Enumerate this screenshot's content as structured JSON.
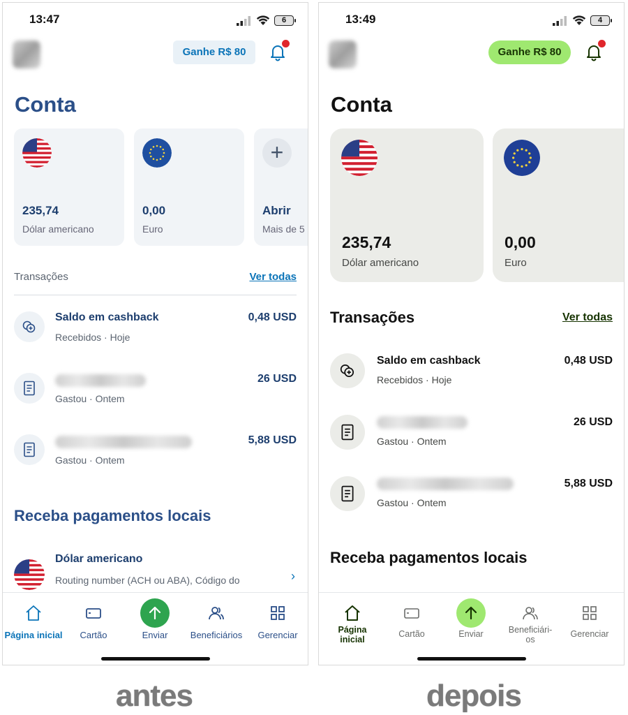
{
  "before": {
    "time": "13:47",
    "battery": "6",
    "earn_label": "Ganhe R$ 80",
    "title": "Conta",
    "cards": [
      {
        "amount": "235,74",
        "currency": "Dólar americano"
      },
      {
        "amount": "0,00",
        "currency": "Euro"
      },
      {
        "amount": "Abrir",
        "currency": "Mais de 5"
      }
    ],
    "transactions_label": "Transações",
    "see_all": "Ver todas",
    "transactions": [
      {
        "name": "Saldo em cashback",
        "sub": "Recebidos · Hoje",
        "value": "0,48 USD"
      },
      {
        "name": "",
        "sub": "Gastou · Ontem",
        "value": "26 USD"
      },
      {
        "name": "",
        "sub": "Gastou · Ontem",
        "value": "5,88 USD"
      }
    ],
    "receive_title": "Receba pagamentos locais",
    "local": {
      "name": "Dólar americano",
      "desc": "Routing number (ACH ou ABA), Código do banco (SWIFT/BIC), Número da conta"
    },
    "tabs": [
      "Página inicial",
      "Cartão",
      "Enviar",
      "Beneficiários",
      "Gerenciar"
    ],
    "caption": "antes",
    "colors": {
      "accent": "#0b74b8",
      "title": "#2b4f88",
      "send": "#2ea44f"
    }
  },
  "after": {
    "time": "13:49",
    "battery": "4",
    "earn_label": "Ganhe R$ 80",
    "title": "Conta",
    "cards": [
      {
        "amount": "235,74",
        "currency": "Dólar americano"
      },
      {
        "amount": "0,00",
        "currency": "Euro"
      }
    ],
    "transactions_label": "Transações",
    "see_all": "Ver todas",
    "transactions": [
      {
        "name": "Saldo em cashback",
        "sub": "Recebidos · Hoje",
        "value": "0,48 USD"
      },
      {
        "name": "",
        "sub": "Gastou · Ontem",
        "value": "26 USD"
      },
      {
        "name": "",
        "sub": "Gastou · Ontem",
        "value": "5,88 USD"
      }
    ],
    "receive_title": "Receba pagamentos locais",
    "tabs": [
      "Página inicial",
      "Cartão",
      "Enviar",
      "Beneficiári-os",
      "Gerenciar"
    ],
    "caption": "depois",
    "colors": {
      "accent": "#9fe870",
      "title": "#111111",
      "send": "#9fe870"
    }
  }
}
